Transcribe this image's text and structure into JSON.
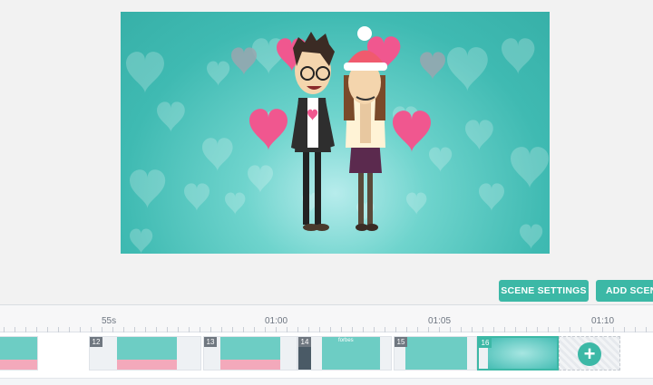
{
  "toolbar": {
    "scene_settings_label": "SCENE SETTINGS",
    "add_scene_label": "ADD SCENE"
  },
  "timeline": {
    "time_markers": [
      "55s",
      "01:00",
      "01:05",
      "01:10"
    ],
    "scenes": [
      {
        "number": "",
        "thumb_text": "",
        "active": false
      },
      {
        "number": "12",
        "thumb_text": "",
        "active": false
      },
      {
        "number": "13",
        "thumb_text": "",
        "active": false
      },
      {
        "number": "14",
        "thumb_text": "forbes",
        "active": false
      },
      {
        "number": "15",
        "thumb_text": "",
        "active": false
      },
      {
        "number": "16",
        "thumb_text": "",
        "active": true
      }
    ],
    "add_icon": "+"
  },
  "colors": {
    "accent": "#3cb8a6",
    "preview_bg": "#3fbab2",
    "heart_pink": "#f0578f",
    "heart_gray": "#9aa6b0"
  },
  "icons": {
    "add_scene": "plus-circle-icon"
  }
}
